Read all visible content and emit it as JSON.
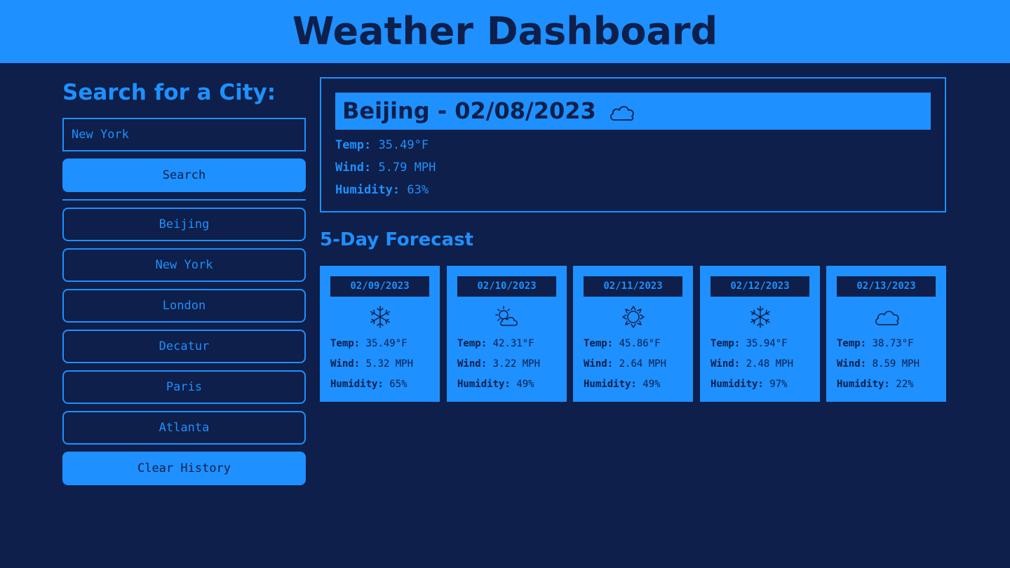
{
  "header": {
    "title": "Weather Dashboard"
  },
  "sidebar": {
    "heading": "Search for a City:",
    "search_value": "New York",
    "search_button": "Search",
    "history": [
      "Beijing",
      "New York",
      "London",
      "Decatur",
      "Paris",
      "Atlanta"
    ],
    "clear_button": "Clear History"
  },
  "current": {
    "title": "Beijing - 02/08/2023",
    "icon": "cloud-icon",
    "temp_label": "Temp:",
    "temp": "35.49°F",
    "wind_label": "Wind:",
    "wind": "5.79 MPH",
    "humidity_label": "Humidity:",
    "humidity": "63%"
  },
  "forecast": {
    "title": "5-Day Forecast",
    "temp_label": "Temp:",
    "wind_label": "Wind:",
    "humidity_label": "Humidity:",
    "days": [
      {
        "date": "02/09/2023",
        "icon": "snowflake-icon",
        "temp": "35.49°F",
        "wind": "5.32 MPH",
        "humidity": "65%"
      },
      {
        "date": "02/10/2023",
        "icon": "sun-behind-cloud-icon",
        "temp": "42.31°F",
        "wind": "3.22 MPH",
        "humidity": "49%"
      },
      {
        "date": "02/11/2023",
        "icon": "sun-icon",
        "temp": "45.86°F",
        "wind": "2.64 MPH",
        "humidity": "49%"
      },
      {
        "date": "02/12/2023",
        "icon": "snowflake-icon",
        "temp": "35.94°F",
        "wind": "2.48 MPH",
        "humidity": "97%"
      },
      {
        "date": "02/13/2023",
        "icon": "cloud-icon",
        "temp": "38.73°F",
        "wind": "8.59 MPH",
        "humidity": "22%"
      }
    ]
  },
  "colors": {
    "background": "#0d1f4a",
    "accent": "#1e90ff"
  }
}
